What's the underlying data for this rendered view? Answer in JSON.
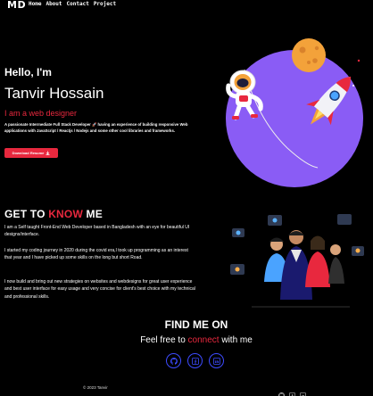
{
  "nav": {
    "logo": "MD",
    "links": [
      "Home",
      "About",
      "Contact",
      "Project"
    ]
  },
  "hero": {
    "greeting": "Hello, I'm",
    "name": "Tanvir Hossain",
    "role": "I am a web designer",
    "description": "A passionate Intermediate Full Stack Developer 🚀 having an experience of building responsive Web applications with JavaScript / Reactjs / Nodejs and some other cool libraries and frameworks.",
    "download_label": "Download Resume",
    "download_icon": "download-icon"
  },
  "about": {
    "title_prefix": "GET TO ",
    "title_highlight": "KNOW",
    "title_suffix": " ME",
    "paragraphs": [
      "I am a Self taught Front-End Web Developer based in Bangladesh with an eye for beautiful UI designs/interface.",
      "I started my coding journey in 2020 during the covid era,I took up programming as an interest that year and I have picked up some skills on the long but short Road.",
      "I now build and bring out new strategies on websites and webdesigns for great user experience and best user interface for easy usage and very concise for client's best choice with my technical and professional skills."
    ]
  },
  "findme": {
    "title": "FIND ME ON",
    "sub_prefix": "Feel free to ",
    "sub_highlight": "connect",
    "sub_suffix": " with me",
    "socials": [
      "github-icon",
      "facebook-icon",
      "linkedin-icon"
    ]
  },
  "footer": {
    "copyright": "© 2023 Tanvir",
    "icons": [
      "github-icon",
      "facebook-icon",
      "linkedin-icon"
    ]
  },
  "colors": {
    "accent": "#e8283e",
    "purple": "#7a5cf0",
    "social_border": "#3d4bff",
    "background": "#000000"
  }
}
